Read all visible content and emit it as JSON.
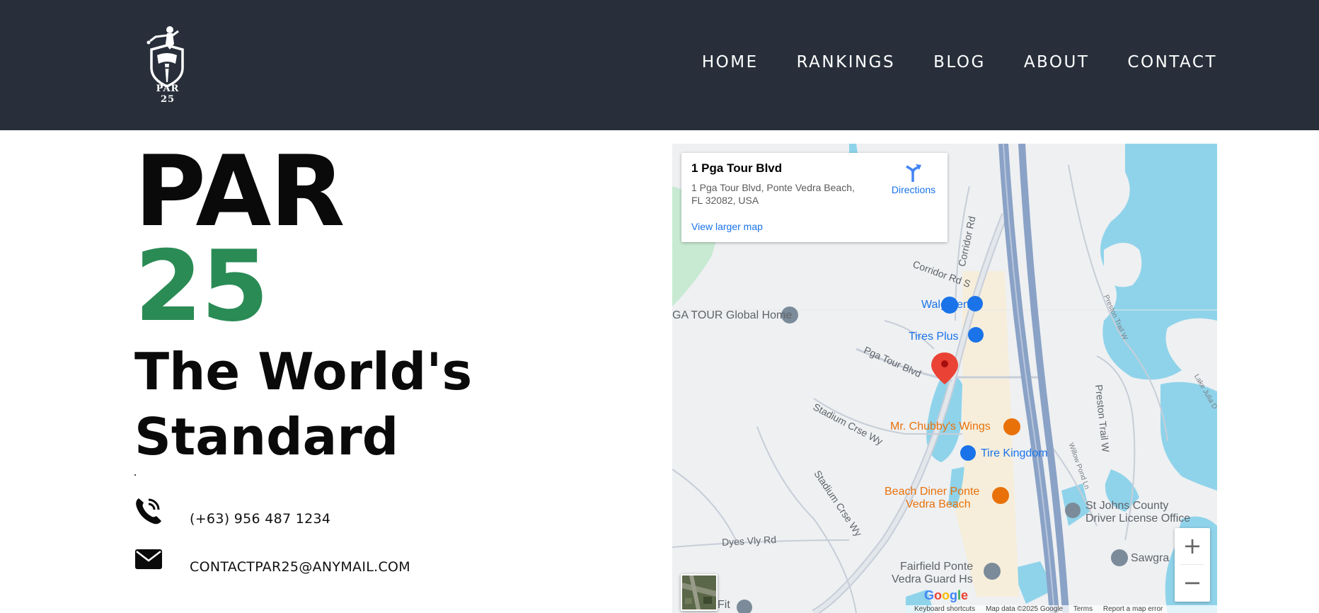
{
  "header": {
    "logo_text": "PAR 25",
    "nav": [
      {
        "label": "HOME"
      },
      {
        "label": "RANKINGS"
      },
      {
        "label": "BLOG"
      },
      {
        "label": "ABOUT"
      },
      {
        "label": "CONTACT"
      }
    ]
  },
  "hero": {
    "word": "PAR",
    "number": "25",
    "tagline_line1": "The World's",
    "tagline_line2": "Standard"
  },
  "contact": {
    "phone": "(+63) 956 487 1234",
    "email": "CONTACTPAR25@ANYMAIL.COM"
  },
  "map": {
    "card": {
      "title": "1 Pga Tour Blvd",
      "address": "1 Pga Tour Blvd, Ponte Vedra Beach, FL 32082, USA",
      "directions": "Directions",
      "larger_map": "View larger map"
    },
    "places": {
      "pga_tour_home": "GA TOUR Global Home",
      "walgreens": "Walgreens",
      "tires_plus": "Tires Plus",
      "mr_chubbys": "Mr. Chubby's Wings",
      "tire_kingdom": "Tire Kingdom",
      "beach_diner_1": "Beach Diner Ponte",
      "beach_diner_2": "Vedra Beach",
      "st_johns_1": "St Johns County",
      "st_johns_2": "Driver License Office",
      "fairfield_1": "Fairfield Ponte",
      "fairfield_2": "Vedra Guard Hs",
      "sawgrass": "Sawgra",
      "fit": "Fit"
    },
    "roads": {
      "corridor_rd": "Corridor Rd",
      "corridor_rd_s": "Corridor Rd S",
      "pga_tour_blvd": "Pga Tour Blvd",
      "stadium_1": "Stadium Crse Wy",
      "stadium_2": "Stadium Crse Wy",
      "dyes_vly": "Dyes Vly Rd",
      "preston_trail": "Preston Trail W",
      "preston_trail_small": "Preston Trail W",
      "willow_pond": "Willow Pond Ln",
      "lake_julia": "Lake Julia D"
    },
    "zoom_in": "+",
    "zoom_out": "−",
    "google": "Google",
    "footer": {
      "shortcuts": "Keyboard shortcuts",
      "data": "Map data ©2025 Google",
      "terms": "Terms",
      "report": "Report a map error"
    },
    "colors": {
      "water": "#8fd3ea",
      "highway": "#8aa2c6",
      "commercial": "#f6eedb",
      "park": "#c8ead3",
      "pin": "#ea4335"
    }
  }
}
